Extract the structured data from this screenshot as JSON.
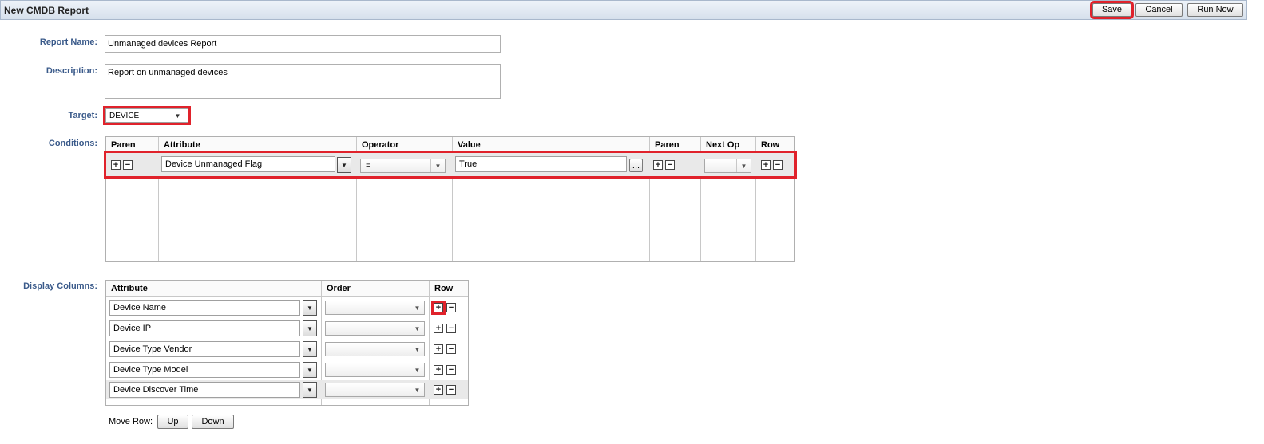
{
  "window": {
    "title": "New CMDB Report"
  },
  "toolbar": {
    "save_label": "Save",
    "cancel_label": "Cancel",
    "run_now_label": "Run Now"
  },
  "form": {
    "report_name_label": "Report Name:",
    "report_name_value": "Unmanaged devices Report",
    "description_label": "Description:",
    "description_value": "Report on unmanaged devices",
    "target_label": "Target:",
    "target_value": "DEVICE",
    "conditions_label": "Conditions:",
    "display_columns_label": "Display Columns:"
  },
  "conditions": {
    "headers": [
      "Paren",
      "Attribute",
      "Operator",
      "Value",
      "Paren",
      "Next Op",
      "Row"
    ],
    "rows": [
      {
        "attribute": "Device Unmanaged Flag",
        "operator": "=",
        "value": "True",
        "value_button": "...",
        "next_op": ""
      }
    ]
  },
  "display_columns": {
    "headers": [
      "Attribute",
      "Order",
      "Row"
    ],
    "rows": [
      {
        "attribute": "Device Name",
        "order": ""
      },
      {
        "attribute": "Device IP",
        "order": ""
      },
      {
        "attribute": "Device Type Vendor",
        "order": ""
      },
      {
        "attribute": "Device Type Model",
        "order": ""
      },
      {
        "attribute": "Device Discover Time",
        "order": ""
      }
    ]
  },
  "move_row": {
    "label": "Move Row:",
    "up_label": "Up",
    "down_label": "Down"
  },
  "icons": {
    "dropdown": "chevron-down-icon",
    "plus": "plus-icon",
    "minus": "minus-icon"
  },
  "colors": {
    "highlight": "#e0222b",
    "label": "#3a5a8a",
    "selected_row": "#e9e9e9"
  }
}
